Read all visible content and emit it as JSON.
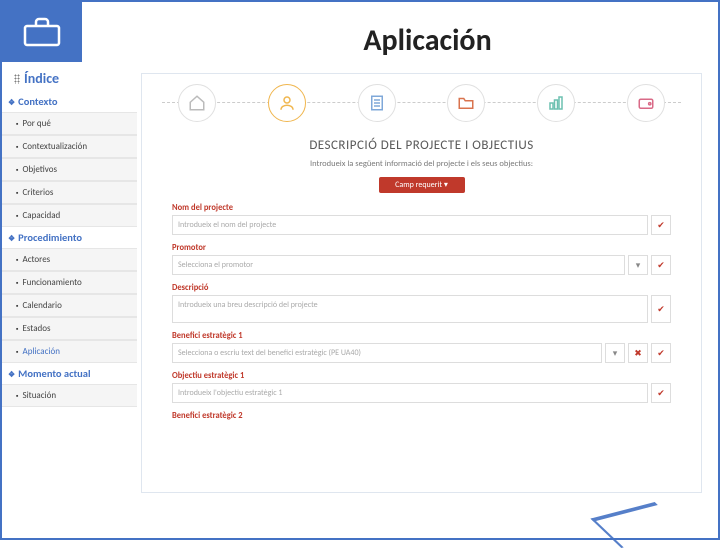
{
  "sidebar": {
    "title": "Índice",
    "sections": [
      {
        "label": "Contexto",
        "items": [
          "Por qué",
          "Contextualización",
          "Objetivos",
          "Criterios",
          "Capacidad"
        ]
      },
      {
        "label": "Procedimiento",
        "items": [
          "Actores",
          "Funcionamiento",
          "Calendario",
          "Estados",
          "Aplicación"
        ]
      },
      {
        "label": "Momento actual",
        "items": [
          "Situación"
        ]
      }
    ]
  },
  "main": {
    "title": "Aplicación"
  },
  "app": {
    "heading": "DESCRIPCIÓ DEL PROJECTE I OBJECTIUS",
    "subheading": "Introdueix la següent informació del projecte i els seus objectius:",
    "required_label": "Camp requerit",
    "fields": {
      "nom": {
        "label": "Nom del projecte",
        "placeholder": "Introdueix el nom del projecte"
      },
      "promotor": {
        "label": "Promotor",
        "placeholder": "Selecciona el promotor"
      },
      "descripcio": {
        "label": "Descripció",
        "placeholder": "Introdueix una breu descripció del projecte"
      },
      "benefici1": {
        "label": "Benefici estratègic 1",
        "placeholder": "Selecciona o escriu text del benefici estratègic (PE UA40)"
      },
      "objectiu1": {
        "label": "Objectiu estratègic 1",
        "placeholder": "Introdueix l'objectiu estratègic 1"
      },
      "benefici2": {
        "label": "Benefici estratègic 2"
      }
    }
  }
}
